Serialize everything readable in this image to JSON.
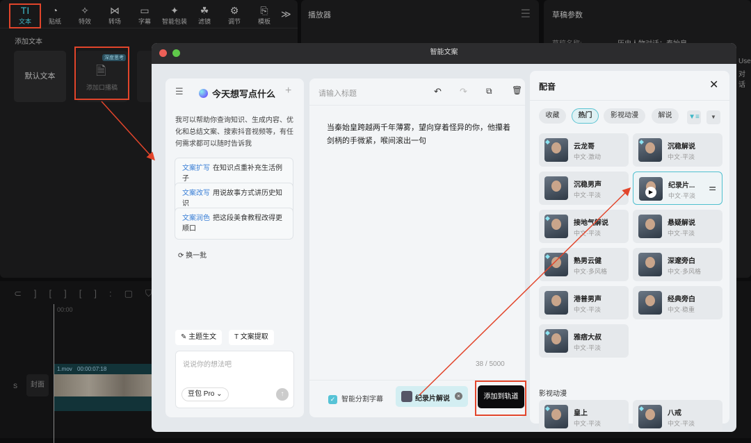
{
  "toolbar": {
    "tabs": [
      {
        "label": "文本",
        "icon": "text-icon"
      },
      {
        "label": "贴纸",
        "icon": "sticker-icon"
      },
      {
        "label": "特效",
        "icon": "effects-icon"
      },
      {
        "label": "转场",
        "icon": "transition-icon"
      },
      {
        "label": "字幕",
        "icon": "subtitle-icon"
      },
      {
        "label": "智能包装",
        "icon": "smart-pack-icon"
      },
      {
        "label": "滤镜",
        "icon": "filter-icon"
      },
      {
        "label": "调节",
        "icon": "adjust-icon"
      },
      {
        "label": "模板",
        "icon": "template-icon"
      }
    ],
    "more": "≫"
  },
  "text_panel": {
    "section": "添加文本",
    "default_text": "默认文本",
    "script_card": "添加口播稿",
    "badge": "深度思考"
  },
  "player": {
    "title": "播放器"
  },
  "draft": {
    "title": "草稿参数",
    "name_label": "草稿名称:",
    "name_value": "历史人物对话：秦始皇",
    "user_snip": "User",
    "snip2": "对话"
  },
  "timeline": {
    "time": "00:00",
    "clip_name": "1.mov",
    "clip_duration": "00:00:07:18",
    "cover": "封面",
    "s": "S"
  },
  "modal": {
    "title": "智能文案",
    "left": {
      "heading": "今天想写点什么",
      "intro": "我可以帮助你查询知识、生成内容、优化和总结文案、搜索抖音视频等，有任何需求都可以随时告诉我",
      "prompts": [
        {
          "tag": "文案扩写",
          "text": "在知识点重补充生活例子"
        },
        {
          "tag": "文案改写",
          "text": "用说故事方式讲历史知识"
        },
        {
          "tag": "文案润色",
          "text": "把这段美食教程改得更顺口"
        }
      ],
      "refresh": "换一批",
      "action1": "主题生文",
      "action2": "文案提取",
      "input_placeholder": "说说你的想法吧",
      "model": "豆包 Pro"
    },
    "editor": {
      "title_placeholder": "请输入标题",
      "body": "当秦始皇跨越两千年薄雾，望向穿着怪异的你，他攥着剑柄的手微紧，喉间滚出一句",
      "count": "38 / 5000",
      "smart_split": "智能分割字幕",
      "selected_voice": "纪录片解说",
      "add_button": "添加到轨道"
    },
    "voice": {
      "title": "配音",
      "chips": [
        "收藏",
        "热门",
        "影视动漫",
        "解说"
      ],
      "active_chip": "热门",
      "voices": [
        {
          "name": "云龙哥",
          "tag": "中文·激动"
        },
        {
          "name": "沉稳解说",
          "tag": "中文·平淡"
        },
        {
          "name": "沉稳男声",
          "tag": "中文·平淡"
        },
        {
          "name": "纪录片...",
          "tag": "中文·平淡"
        },
        {
          "name": "接地气解说",
          "tag": "中文·平淡"
        },
        {
          "name": "悬疑解说",
          "tag": "中文·平淡"
        },
        {
          "name": "熟男云健",
          "tag": "中文·多风格"
        },
        {
          "name": "深邃旁白",
          "tag": "中文·多风格"
        },
        {
          "name": "港普男声",
          "tag": "中文·平淡"
        },
        {
          "name": "经典旁白",
          "tag": "中文·稳重"
        },
        {
          "name": "雅痞大叔",
          "tag": "中文·平淡"
        }
      ],
      "section2": "影视动漫",
      "voices2": [
        {
          "name": "皇上",
          "tag": "中文·平淡"
        },
        {
          "name": "八戒",
          "tag": "中文·平淡"
        }
      ]
    }
  },
  "colors": {
    "accent": "#3fb7c6",
    "annotation": "#e2452b"
  }
}
